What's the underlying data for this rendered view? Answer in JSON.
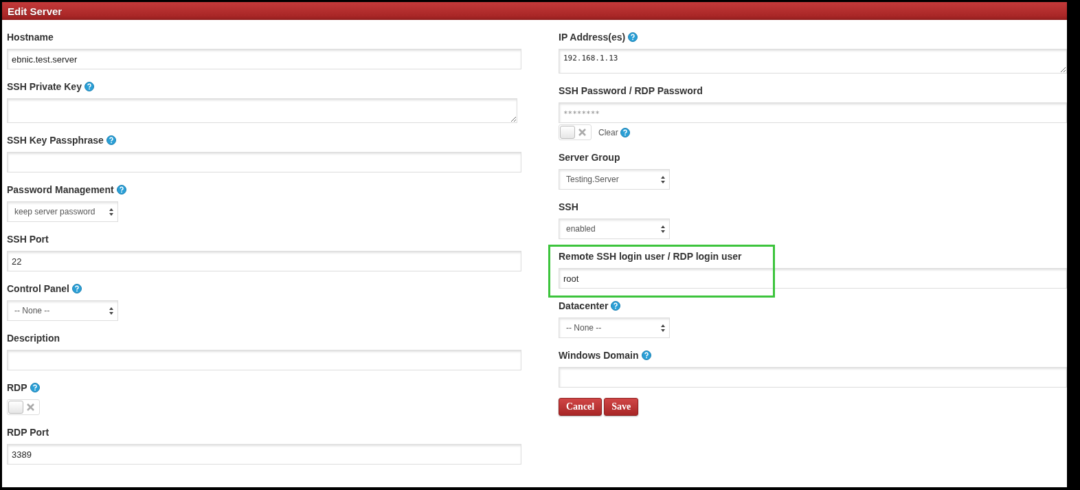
{
  "title": "Edit Server",
  "columns": [
    {
      "fields": [
        {
          "kind": "text",
          "label": "Hostname",
          "help": false,
          "highlighted": false,
          "value": "ebnic.test.server"
        },
        {
          "kind": "textarea",
          "label": "SSH Private Key",
          "help": true,
          "highlighted": false
        },
        {
          "kind": "text",
          "label": "SSH Key Passphrase",
          "help": true,
          "highlighted": false
        },
        {
          "kind": "select",
          "label": "Password Management",
          "help": true,
          "highlighted": false,
          "value": "keep server password"
        },
        {
          "kind": "text",
          "label": "SSH Port",
          "help": false,
          "highlighted": false,
          "value": "22"
        },
        {
          "kind": "select",
          "label": "Control Panel",
          "help": true,
          "highlighted": false,
          "value": "-- None --"
        },
        {
          "kind": "text",
          "label": "Description",
          "help": false,
          "highlighted": false
        },
        {
          "kind": "toggle",
          "label": "RDP",
          "help": true,
          "highlighted": false,
          "on": false
        },
        {
          "kind": "text",
          "label": "RDP Port",
          "help": false,
          "highlighted": false,
          "value": "3389"
        }
      ]
    },
    {
      "fields": [
        {
          "kind": "textarea",
          "label": "IP Address(es)",
          "help": true,
          "highlighted": false,
          "value": "192.168.1.13"
        },
        {
          "kind": "password",
          "label": "SSH Password / RDP Password",
          "help": false,
          "highlighted": false,
          "placeholder": "********",
          "clear": {
            "label": "Clear",
            "help": true,
            "on": false
          }
        },
        {
          "kind": "select",
          "label": "Server Group",
          "help": false,
          "highlighted": false,
          "value": "Testing.Server"
        },
        {
          "kind": "select",
          "label": "SSH",
          "help": false,
          "highlighted": false,
          "value": "enabled"
        },
        {
          "kind": "text",
          "label": "Remote SSH login user / RDP login user",
          "help": false,
          "highlighted": true,
          "value": "root"
        },
        {
          "kind": "select",
          "label": "Datacenter",
          "help": true,
          "highlighted": false,
          "value": "-- None --"
        },
        {
          "kind": "text",
          "label": "Windows Domain",
          "help": true,
          "highlighted": false
        }
      ]
    }
  ],
  "buttons": [
    {
      "label": "Cancel"
    },
    {
      "label": "Save"
    }
  ]
}
